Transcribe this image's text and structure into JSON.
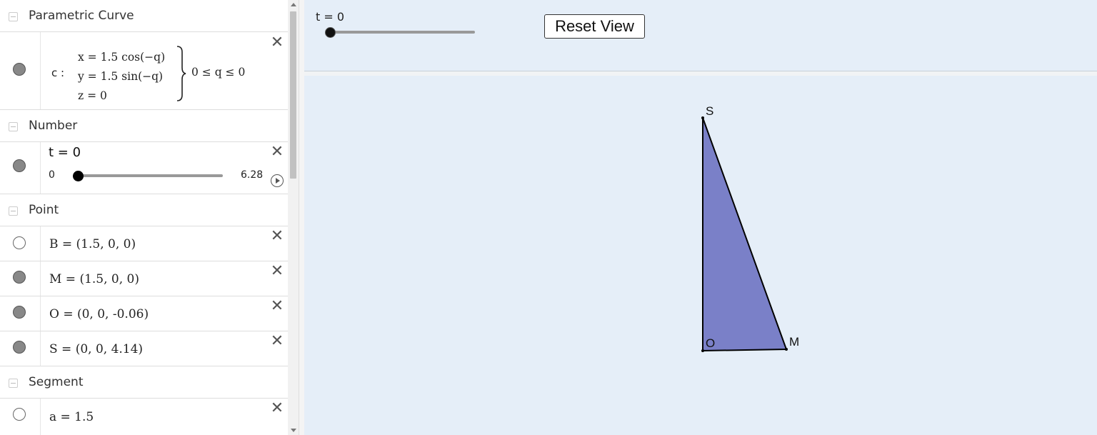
{
  "algebra": {
    "sections": {
      "parametric_curve": "Parametric Curve",
      "number": "Number",
      "point": "Point",
      "segment": "Segment"
    },
    "curve": {
      "name": "c :",
      "x_eq": "x = 1.5  cos(−q)",
      "y_eq": "y = 1.5  sin(−q)",
      "z_eq": "z = 0",
      "range": "0 ≤ q ≤ 0"
    },
    "number": {
      "label": "t = 0",
      "min": "0",
      "max": "6.28",
      "value": 0
    },
    "points": [
      {
        "expr": "B = (1.5, 0, 0)",
        "visible": false
      },
      {
        "expr": "M = (1.5, 0, 0)",
        "visible": true
      },
      {
        "expr": "O = (0, 0, -0.06)",
        "visible": true
      },
      {
        "expr": "S = (0, 0, 4.14)",
        "visible": true
      }
    ],
    "segment": {
      "expr": "a = 1.5",
      "visible": false
    }
  },
  "graphics": {
    "slider_label": "t = 0",
    "slider_value": 0,
    "reset_button": "Reset View",
    "triangle_color": "#7a80c8",
    "labels": {
      "S": "S",
      "O": "O",
      "M": "M"
    }
  },
  "icons": {
    "close": "close-icon",
    "collapse": "collapse-toggle-icon",
    "play": "play-icon"
  }
}
